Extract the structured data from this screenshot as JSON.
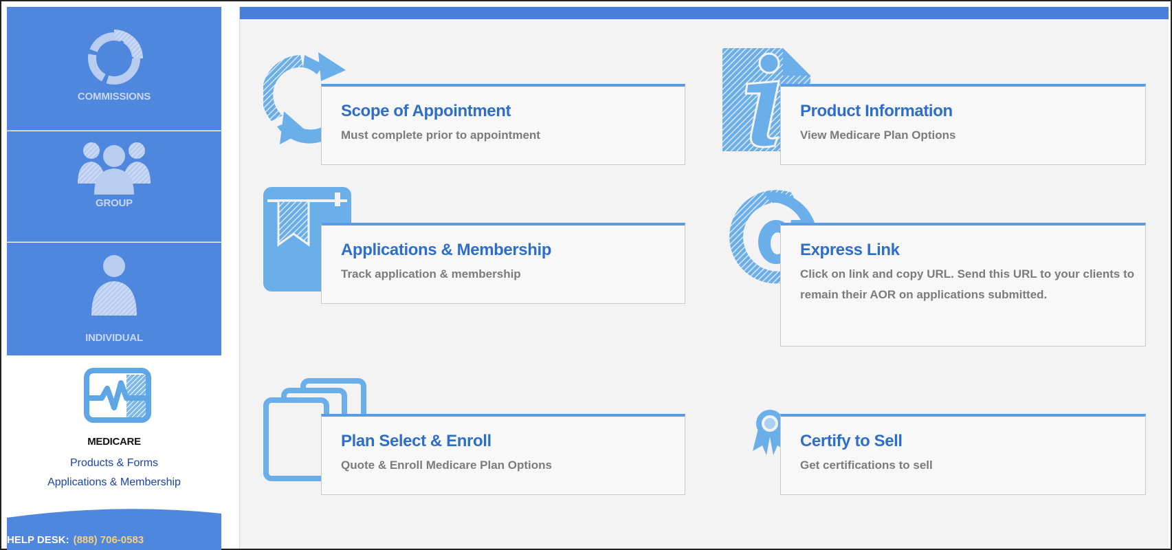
{
  "sidebar": {
    "items": [
      {
        "label": "COMMISSIONS",
        "icon": "donut-chart-icon"
      },
      {
        "label": "GROUP",
        "icon": "group-people-icon"
      },
      {
        "label": "INDIVIDUAL",
        "icon": "person-icon"
      }
    ],
    "active": {
      "label": "MEDICARE",
      "icon": "heartbeat-monitor-icon",
      "links": [
        "Products & Forms",
        "Applications & Membership"
      ]
    }
  },
  "helpdesk": {
    "label": "HELP DESK:",
    "phone": "(888) 706-0583"
  },
  "tiles": [
    {
      "title": "Scope of Appointment",
      "subtitle": "Must complete prior to appointment",
      "icon": "refresh-arrows-icon"
    },
    {
      "title": "Product Information",
      "subtitle": "View Medicare Plan Options",
      "icon": "info-icon"
    },
    {
      "title": "Applications & Membership",
      "subtitle": "Track application & membership",
      "icon": "book-bookmark-icon"
    },
    {
      "title": "Express Link",
      "subtitle": "Click on link and copy URL. Send this URL to your clients to remain their AOR on applications submitted.",
      "icon": "at-sign-icon"
    },
    {
      "title": "Plan Select & Enroll",
      "subtitle": "Quote & Enroll Medicare Plan Options",
      "icon": "stacked-documents-icon"
    },
    {
      "title": "Certify to Sell",
      "subtitle": "Get certifications to sell",
      "icon": "award-ribbon-icon"
    }
  ],
  "colors": {
    "sidebar_blue": "#4f86de",
    "title_blue": "#2e6ec9",
    "card_border_blue": "#5b9be2",
    "icon_blue": "#6aaeea",
    "phone_yellow": "#f3d27a"
  }
}
